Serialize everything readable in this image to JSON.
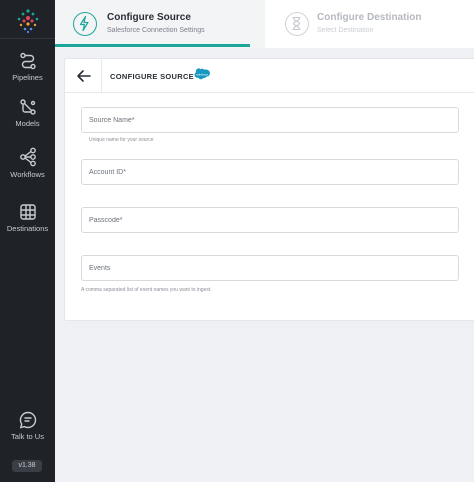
{
  "sidebar": {
    "items": [
      {
        "label": "Pipelines",
        "icon": "pipelines-icon"
      },
      {
        "label": "Models",
        "icon": "models-icon"
      },
      {
        "label": "Workflows",
        "icon": "workflows-icon"
      },
      {
        "label": "Destinations",
        "icon": "destinations-icon"
      }
    ],
    "talk_label": "Talk to Us",
    "version": "v1.38"
  },
  "stepper": {
    "steps": [
      {
        "title": "Configure Source",
        "subtitle": "Salesforce Connection Settings",
        "icon": "lightning-icon",
        "active": true
      },
      {
        "title": "Configure Destination",
        "subtitle": "Select Destination",
        "icon": "hourglass-icon",
        "active": false
      }
    ]
  },
  "card": {
    "title": "CONFIGURE SOURCE",
    "logo_text": "salesforce",
    "fields": [
      {
        "placeholder": "Source Name*",
        "value": "",
        "helper": "Unique name for your source"
      },
      {
        "placeholder": "Account ID*",
        "value": "",
        "helper": ""
      },
      {
        "placeholder": "Passcode*",
        "value": "",
        "helper": ""
      },
      {
        "placeholder": "Events",
        "value": "",
        "helper": "A comma separated list of event names you want to ingest."
      }
    ]
  },
  "colors": {
    "accent": "#1ea69a",
    "sidebar_bg": "#1f2227",
    "salesforce_blue": "#1798c1"
  }
}
